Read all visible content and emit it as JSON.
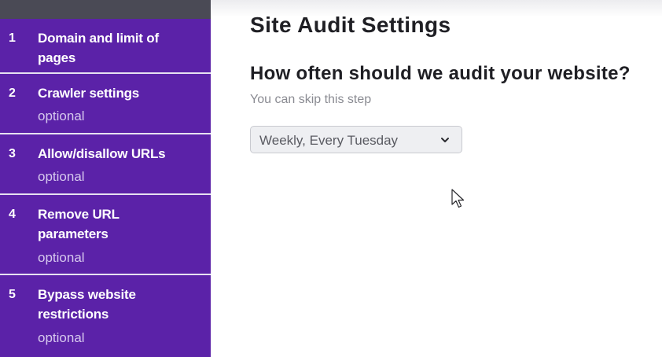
{
  "sidebar": {
    "steps": [
      {
        "number": "1",
        "title": "Domain and limit of pages",
        "optional": ""
      },
      {
        "number": "2",
        "title": "Crawler settings",
        "optional": "optional"
      },
      {
        "number": "3",
        "title": "Allow/disallow URLs",
        "optional": "optional"
      },
      {
        "number": "4",
        "title": "Remove URL parameters",
        "optional": "optional"
      },
      {
        "number": "5",
        "title": "Bypass website restrictions",
        "optional": "optional"
      }
    ]
  },
  "main": {
    "title": "Site Audit Settings",
    "question": "How often should we audit your website?",
    "hint": "You can skip this step",
    "schedule_select": {
      "value": "Weekly, Every Tuesday"
    }
  },
  "colors": {
    "sidebar_bg": "#5b22a8",
    "sidebar_divider": "#e7e1f2",
    "text_primary": "#1f1f24",
    "text_hint": "#8a8b92"
  },
  "icons": {
    "select_chevron": "chevron-down-icon",
    "pointer": "mouse-cursor-icon"
  }
}
